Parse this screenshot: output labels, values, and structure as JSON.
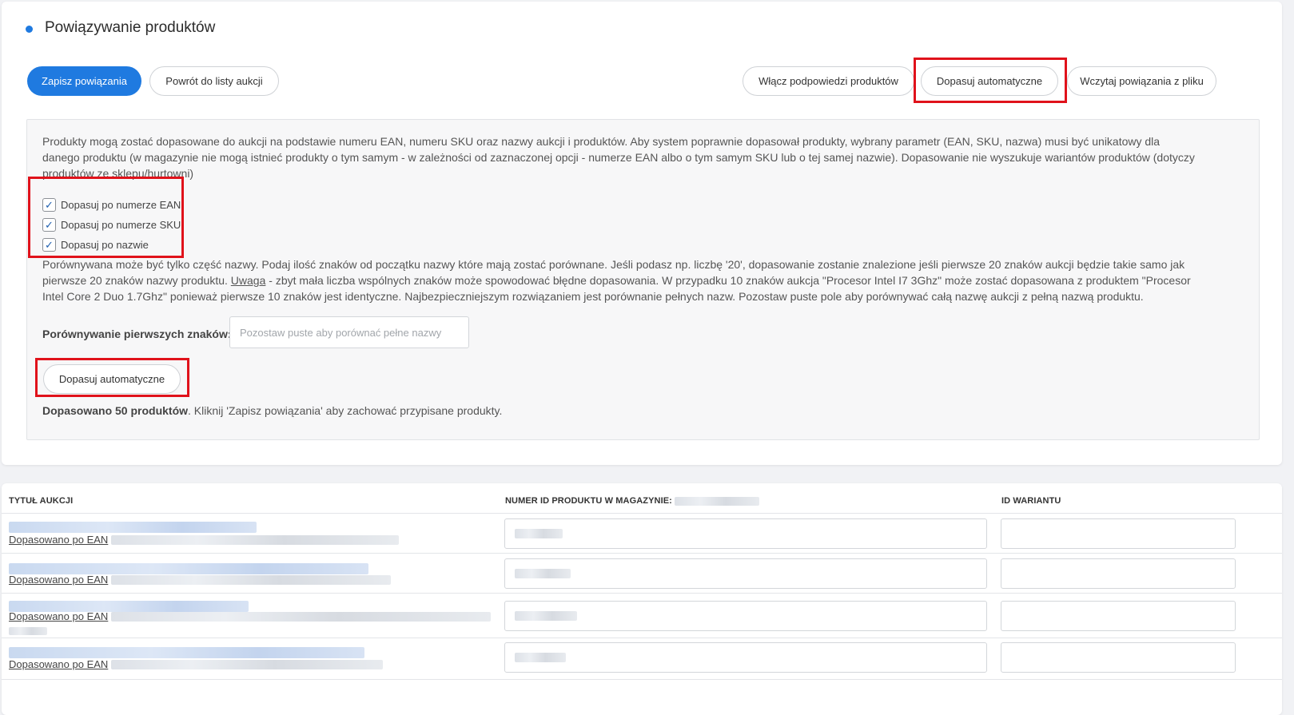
{
  "colors": {
    "accent": "#1f7ae0",
    "highlight": "#e0121b"
  },
  "page": {
    "title": "Powiązywanie produktów",
    "title_dot_icon": "dot-icon"
  },
  "toolbar": {
    "save_label": "Zapisz powiązania",
    "back_label": "Powrót do listy aukcji",
    "hints_label": "Włącz podpowiedzi produktów",
    "auto_match_label": "Dopasuj automatyczne",
    "load_file_label": "Wczytaj powiązania z pliku"
  },
  "info": {
    "intro_lines": [
      "Produkty mogą zostać dopasowane do aukcji na podstawie numeru EAN, numeru SKU oraz nazwy aukcji i produktów. Aby system poprawnie dopasował produkty, wybrany parametr (EAN, SKU, nazwa) musi być unikatowy dla",
      "danego produktu (w magazynie nie mogą istnieć produkty o tym samym - w zależności od zaznaczonej opcji - numerze EAN albo o tym samym SKU lub o tej samej nazwie). Dopasowanie nie wyszukuje wariantów produktów (dotyczy",
      "produktów ze sklepu/hurtowni)"
    ],
    "checkboxes": [
      {
        "label": "Dopasuj po numerze EAN",
        "checked": true
      },
      {
        "label": "Dopasuj po numerze SKU",
        "checked": true
      },
      {
        "label": "Dopasuj po nazwie",
        "checked": true
      }
    ],
    "check_icon": "check-icon",
    "compare_line1": "Porównywana może być tylko część nazwy. Podaj ilość znaków od początku nazwy które mają zostać porównane. Jeśli podasz np. liczbę '20', dopasowanie zostanie znalezione jeśli pierwsze 20 znaków aukcji będzie takie samo jak",
    "compare_line2_pre": "pierwsze 20 znaków nazwy produktu.",
    "compare_line2_warn": "Uwaga",
    "compare_line2_post": "- zbyt mała liczba wspólnych znaków może spowodować błędne dopasowania. W przypadku 10 znaków aukcja \"Procesor Intel I7 3Ghz\" może zostać dopasowana z produktem \"Procesor",
    "compare_line3": "Intel Core 2 Duo 1.7Ghz\" ponieważ pierwsze 10 znaków jest identyczne. Najbezpieczniejszym rozwiązaniem jest porównanie pełnych nazw. Pozostaw puste pole aby porównywać całą nazwę aukcji z pełną nazwą produktu.",
    "compare_label": "Porównywanie pierwszych znaków:",
    "compare_placeholder": "Pozostaw puste aby porównać pełne nazwy",
    "compare_value": "",
    "auto_match_label": "Dopasuj automatyczne",
    "result_bold": "Dopasowano 50 produktów",
    "result_rest": ". Kliknij 'Zapisz powiązania' aby zachować przypisane produkty."
  },
  "table": {
    "headers": [
      "TYTUŁ AUKCJI",
      "NUMER ID PRODUKTU W MAGAZYNIE:",
      "ID WARIANTU"
    ],
    "rows": [
      {
        "match_label": "Dopasowano po EAN",
        "variant_id": ""
      },
      {
        "match_label": "Dopasowano po EAN",
        "variant_id": ""
      },
      {
        "match_label": "Dopasowano po EAN",
        "variant_id": ""
      },
      {
        "match_label": "Dopasowano po EAN",
        "variant_id": ""
      }
    ]
  }
}
